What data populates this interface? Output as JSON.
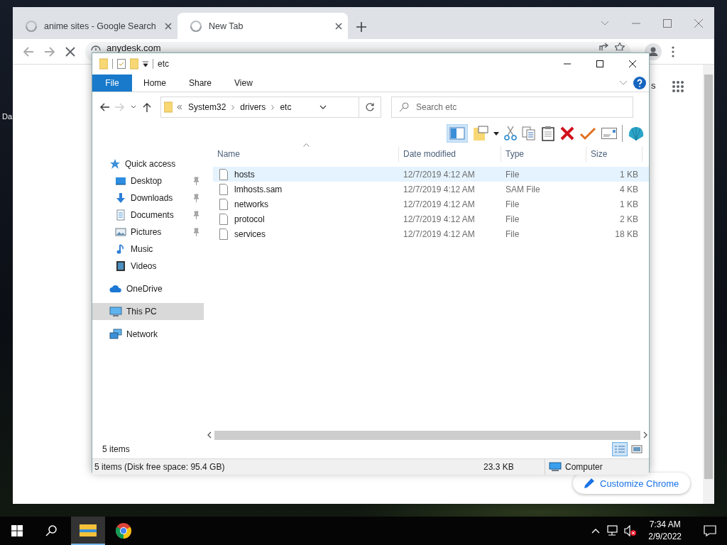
{
  "desktop": {
    "icon_label": "Da"
  },
  "browser": {
    "tabs": [
      {
        "title": "anime sites - Google Search",
        "selected": false
      },
      {
        "title": "New Tab",
        "selected": true
      }
    ],
    "address": "anydesk.com",
    "page_link_fragment": "s",
    "customize_button": "Customize Chrome"
  },
  "explorer": {
    "title": "etc",
    "ribbon_tabs": [
      {
        "label": "File",
        "selected": true
      },
      {
        "label": "Home",
        "selected": false
      },
      {
        "label": "Share",
        "selected": false
      },
      {
        "label": "View",
        "selected": false
      }
    ],
    "breadcrumb": [
      "System32",
      "drivers",
      "etc"
    ],
    "search": {
      "placeholder": "Search etc"
    },
    "nav": [
      {
        "label": "Quick access",
        "kind": "star",
        "selected": false,
        "children": [
          {
            "label": "Desktop",
            "kind": "desktop",
            "pinned": true,
            "selected": false
          },
          {
            "label": "Downloads",
            "kind": "downloads",
            "pinned": true,
            "selected": false
          },
          {
            "label": "Documents",
            "kind": "documents",
            "pinned": true,
            "selected": false
          },
          {
            "label": "Pictures",
            "kind": "pictures",
            "pinned": true,
            "selected": false
          },
          {
            "label": "Music",
            "kind": "music",
            "pinned": false,
            "selected": false
          },
          {
            "label": "Videos",
            "kind": "videos",
            "pinned": false,
            "selected": false
          }
        ]
      },
      {
        "label": "OneDrive",
        "kind": "cloud",
        "selected": false
      },
      {
        "label": "This PC",
        "kind": "computer",
        "selected": true
      },
      {
        "label": "Network",
        "kind": "network",
        "selected": false
      }
    ],
    "columns": [
      "Name",
      "Date modified",
      "Type",
      "Size"
    ],
    "files": [
      {
        "name": "hosts",
        "date": "12/7/2019 4:12 AM",
        "type": "File",
        "size": "1 KB",
        "selected": true
      },
      {
        "name": "lmhosts.sam",
        "date": "12/7/2019 4:12 AM",
        "type": "SAM File",
        "size": "4 KB",
        "selected": false
      },
      {
        "name": "networks",
        "date": "12/7/2019 4:12 AM",
        "type": "File",
        "size": "1 KB",
        "selected": false
      },
      {
        "name": "protocol",
        "date": "12/7/2019 4:12 AM",
        "type": "File",
        "size": "2 KB",
        "selected": false
      },
      {
        "name": "services",
        "date": "12/7/2019 4:12 AM",
        "type": "File",
        "size": "18 KB",
        "selected": false
      }
    ],
    "item_count": "5 items",
    "status": {
      "summary": "5 items (Disk free space: 95.4 GB)",
      "size": "23.3 KB",
      "location": "Computer"
    }
  },
  "taskbar": {
    "apps": [
      {
        "kind": "explorer",
        "active": true
      },
      {
        "kind": "chrome",
        "active": false
      }
    ],
    "time": "7:34 AM",
    "date": "2/9/2022"
  }
}
